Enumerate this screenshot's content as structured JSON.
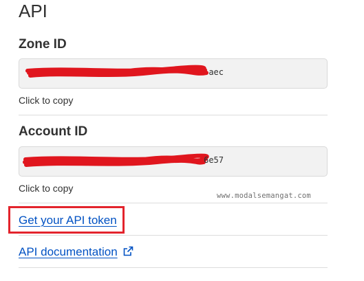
{
  "section": {
    "title": "API"
  },
  "zone": {
    "label": "Zone ID",
    "value_suffix": "aec",
    "hint": "Click to copy"
  },
  "account": {
    "label": "Account ID",
    "value_suffix": "6e57",
    "hint": "Click to copy"
  },
  "watermark": "www.modalsemangat.com",
  "links": {
    "api_token": "Get your API token",
    "api_docs": "API documentation"
  },
  "icons": {
    "external": "external-link-icon"
  },
  "colors": {
    "link": "#0051c3",
    "highlight": "#e3232c",
    "redaction": "#e0161e"
  }
}
